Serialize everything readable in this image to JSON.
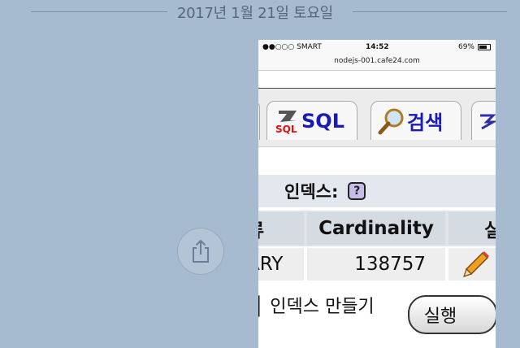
{
  "date_header": "2017년 1월 21일 토요일",
  "status_bar": {
    "carrier": "●●○○○ SMART",
    "time": "14:52",
    "battery": "69%"
  },
  "url": "nodejs-001.cafe24.com",
  "tabs": [
    {
      "label": "SQL"
    },
    {
      "label": "검색"
    }
  ],
  "section": {
    "title": "인덱스:",
    "help": "?"
  },
  "table": {
    "headers": [
      "류",
      "Cardinality",
      "실"
    ],
    "rows": [
      [
        "ARY",
        "138757",
        ""
      ]
    ]
  },
  "create": {
    "text": "│ 인덱스 만들기",
    "button": "실행"
  }
}
